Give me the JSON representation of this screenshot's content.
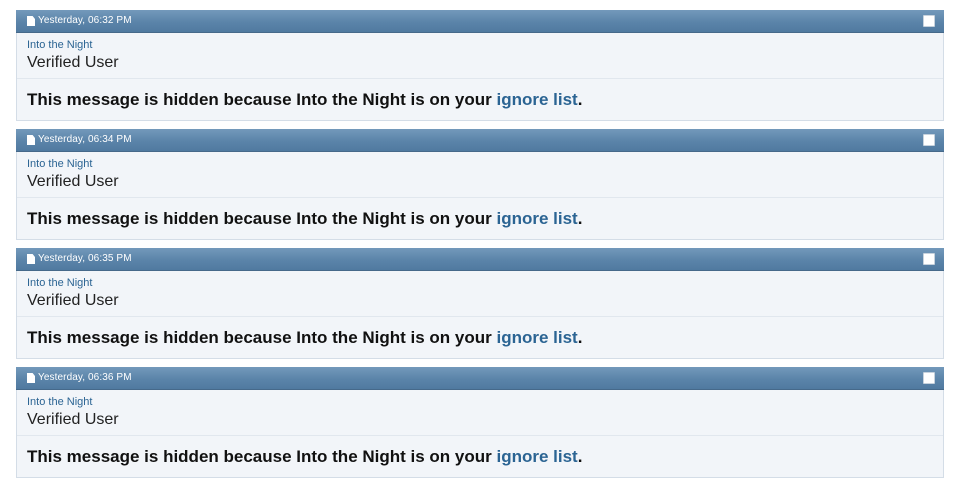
{
  "posts": [
    {
      "date": "Yesterday, 06:32 PM",
      "username": "Into the Night",
      "user_title": "Verified User",
      "message_prefix": "This message is hidden because Into the Night is on your ",
      "ignore_link": "ignore list",
      "message_suffix": "."
    },
    {
      "date": "Yesterday, 06:34 PM",
      "username": "Into the Night",
      "user_title": "Verified User",
      "message_prefix": "This message is hidden because Into the Night is on your ",
      "ignore_link": "ignore list",
      "message_suffix": "."
    },
    {
      "date": "Yesterday, 06:35 PM",
      "username": "Into the Night",
      "user_title": "Verified User",
      "message_prefix": "This message is hidden because Into the Night is on your ",
      "ignore_link": "ignore list",
      "message_suffix": "."
    },
    {
      "date": "Yesterday, 06:36 PM",
      "username": "Into the Night",
      "user_title": "Verified User",
      "message_prefix": "This message is hidden because Into the Night is on your ",
      "ignore_link": "ignore list",
      "message_suffix": "."
    }
  ],
  "icons": {
    "post_icon": "document-icon",
    "select_icon": "checkbox-icon"
  },
  "colors": {
    "header_bar": "#5b84a9",
    "link": "#2b6493",
    "post_background": "#f2f5f9"
  }
}
